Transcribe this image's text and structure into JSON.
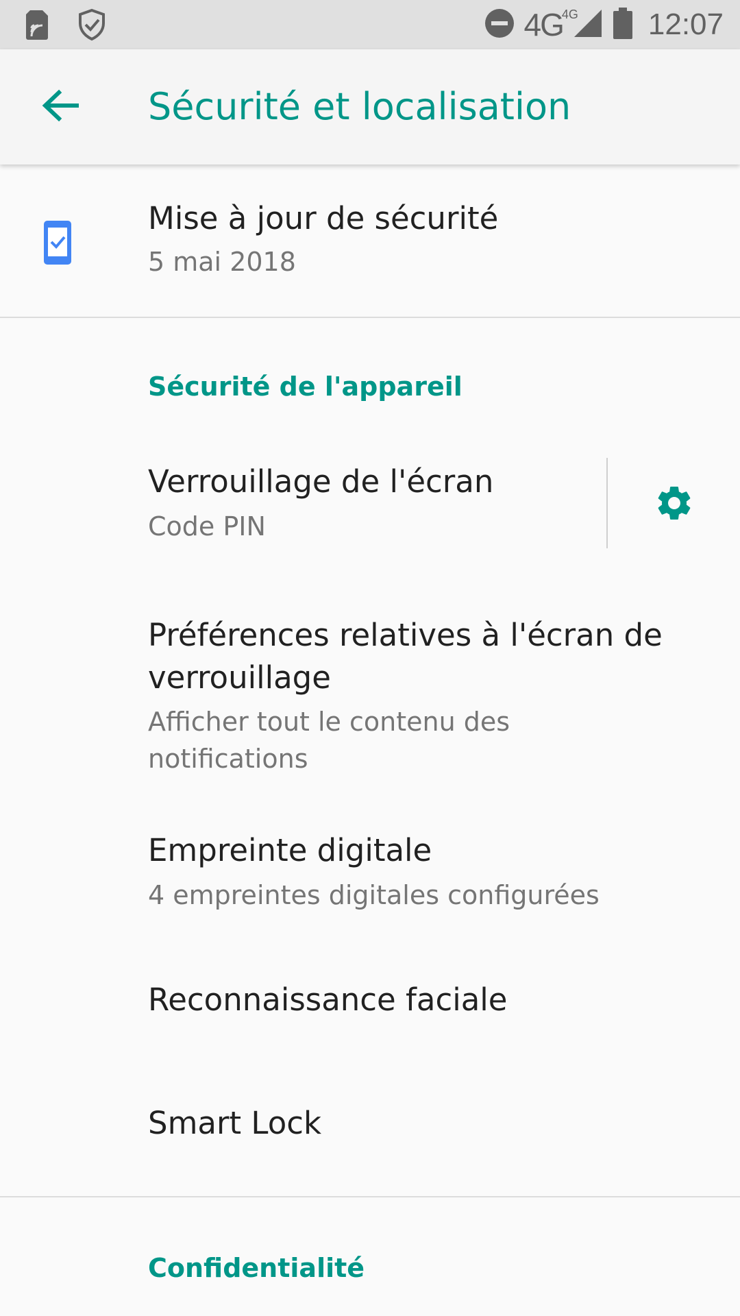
{
  "status_bar": {
    "time": "12:07",
    "network": "4G",
    "network_sup": "4G",
    "icons": [
      "sim-card-icon",
      "shield-check-icon",
      "do-not-disturb-icon",
      "signal-icon",
      "battery-icon"
    ]
  },
  "app_bar": {
    "back_icon": "arrow-back-icon",
    "title": "Sécurité et localisation"
  },
  "security_update": {
    "icon": "phone-check-icon",
    "title": "Mise à jour de sécurité",
    "subtitle": "5 mai 2018"
  },
  "device_security": {
    "header": "Sécurité de l'appareil",
    "items": [
      {
        "title": "Verrouillage de l'écran",
        "subtitle": "Code PIN",
        "icon": "gear-icon"
      },
      {
        "title": "Préférences relatives à l'écran de verrouillage",
        "subtitle": "Afficher tout le contenu des notifications"
      },
      {
        "title": "Empreinte digitale",
        "subtitle": "4 empreintes digitales configurées"
      },
      {
        "title": "Reconnaissance faciale"
      },
      {
        "title": "Smart Lock"
      }
    ]
  },
  "privacy": {
    "header": "Confidentialité"
  },
  "colors": {
    "accent": "#009688",
    "status_bar": "#e0e0e0",
    "app_bar": "#f5f5f5",
    "background": "#fafafa",
    "update_icon": "#4285f4"
  }
}
